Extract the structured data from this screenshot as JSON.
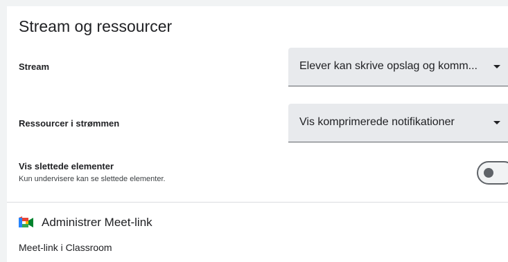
{
  "section": {
    "title": "Stream og ressourcer"
  },
  "stream": {
    "label": "Stream",
    "value": "Elever kan skrive opslag og komm..."
  },
  "resources": {
    "label": "Ressourcer i strømmen",
    "value": "Vis komprimerede notifikationer"
  },
  "deleted": {
    "label": "Vis slettede elementer",
    "sublabel": "Kun undervisere kan se slettede elementer.",
    "toggle_on": false
  },
  "meet": {
    "title": "Administrer Meet-link",
    "link_label": "Meet-link i Classroom",
    "icon": "google-meet-icon"
  },
  "colors": {
    "select_bg": "#e8eaed",
    "divider": "#dadce0",
    "toggle": "#5f6368"
  }
}
